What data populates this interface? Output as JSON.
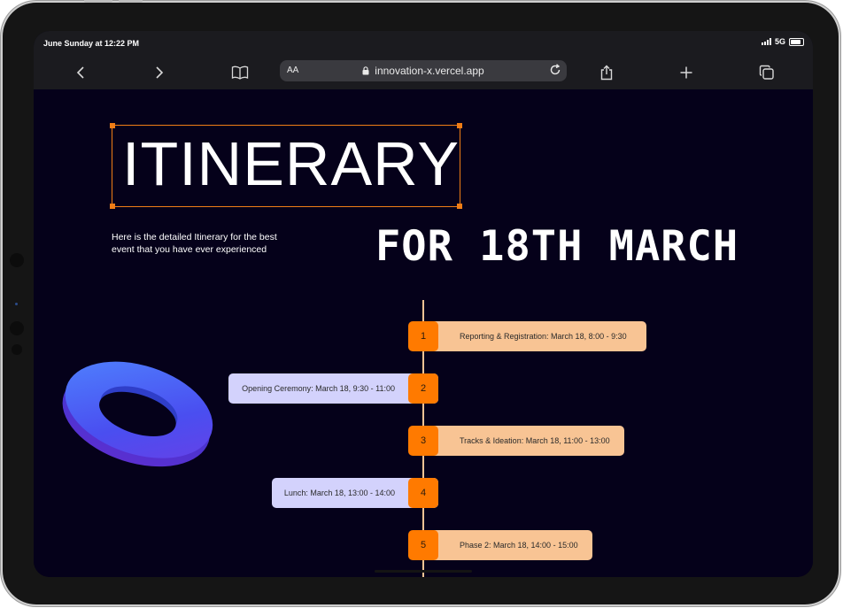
{
  "status_bar": {
    "time": "June Sunday at 12:22 PM",
    "network": "5G"
  },
  "browser": {
    "text_size_label": "AA",
    "url": "innovation-x.vercel.app",
    "icons": [
      "back-icon",
      "forward-icon",
      "bookmarks-icon",
      "lock-icon",
      "reload-icon",
      "share-icon",
      "new-tab-icon",
      "tabs-icon"
    ]
  },
  "page": {
    "title": "ITINERARY",
    "subtitle": "FOR 18TH MARCH",
    "description": "Here is the detailed Itinerary for the best event that you have ever experienced",
    "accent_color": "#ef7d16",
    "background_color": "#05011a"
  },
  "itinerary": [
    {
      "number": "1",
      "text": "Reporting & Registration: March 18, 8:00 - 9:30",
      "side": "right"
    },
    {
      "number": "2",
      "text": "Opening Ceremony: March 18, 9:30 - 11:00",
      "side": "left"
    },
    {
      "number": "3",
      "text": "Tracks & Ideation: March 18, 11:00 - 13:00",
      "side": "right"
    },
    {
      "number": "4",
      "text": "Lunch: March 18, 13:00 - 14:00",
      "side": "left"
    },
    {
      "number": "5",
      "text": "Phase 2: March 18, 14:00 - 15:00",
      "side": "right"
    }
  ]
}
